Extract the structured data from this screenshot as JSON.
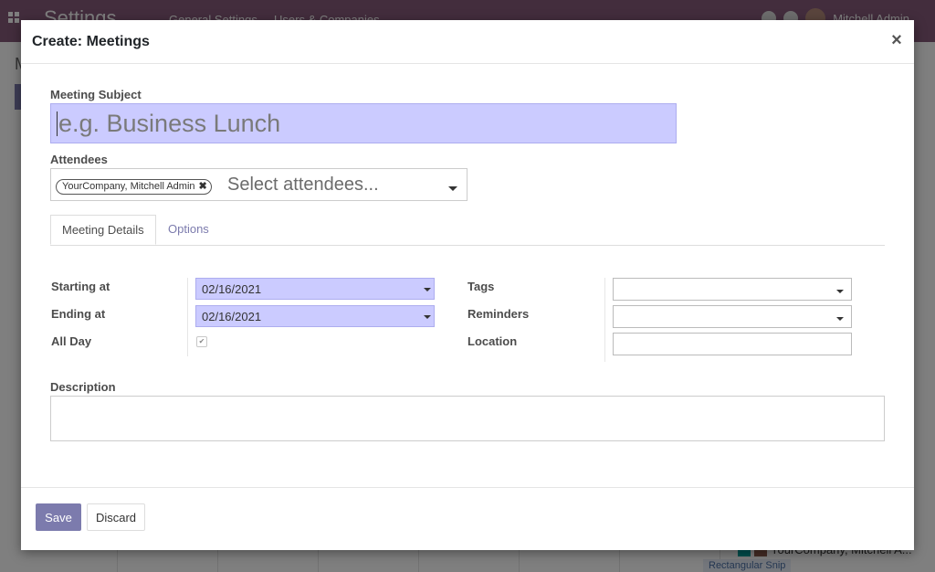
{
  "background": {
    "app_title": "Settings",
    "menu_items": [
      "General Settings",
      "Users & Companies"
    ],
    "user_name": "Mitchell Admin",
    "breadcrumb_letter": "M",
    "event_label": "YourCompany, Mitchell A...",
    "event_label_2": "Rectangular Snip"
  },
  "dialog": {
    "title": "Create: Meetings",
    "close_glyph": "×",
    "meeting_subject": {
      "label": "Meeting Subject",
      "placeholder": "e.g. Business Lunch",
      "value": ""
    },
    "attendees": {
      "label": "Attendees",
      "tags": [
        "YourCompany, Mitchell Admin"
      ],
      "placeholder": "Select attendees..."
    },
    "tabs": [
      {
        "label": "Meeting Details",
        "active": true
      },
      {
        "label": "Options",
        "active": false
      }
    ],
    "details": {
      "starting_at": {
        "label": "Starting at",
        "value": "02/16/2021"
      },
      "ending_at": {
        "label": "Ending at",
        "value": "02/16/2021"
      },
      "all_day": {
        "label": "All Day",
        "checked": true
      },
      "tags": {
        "label": "Tags",
        "value": ""
      },
      "reminders": {
        "label": "Reminders",
        "value": ""
      },
      "location": {
        "label": "Location",
        "value": ""
      }
    },
    "description": {
      "label": "Description",
      "value": ""
    },
    "footer": {
      "save_label": "Save",
      "discard_label": "Discard"
    }
  },
  "colors": {
    "primary": "#7c7bad",
    "navbar": "#875a7b",
    "required_field_bg": "#cbcbff"
  }
}
